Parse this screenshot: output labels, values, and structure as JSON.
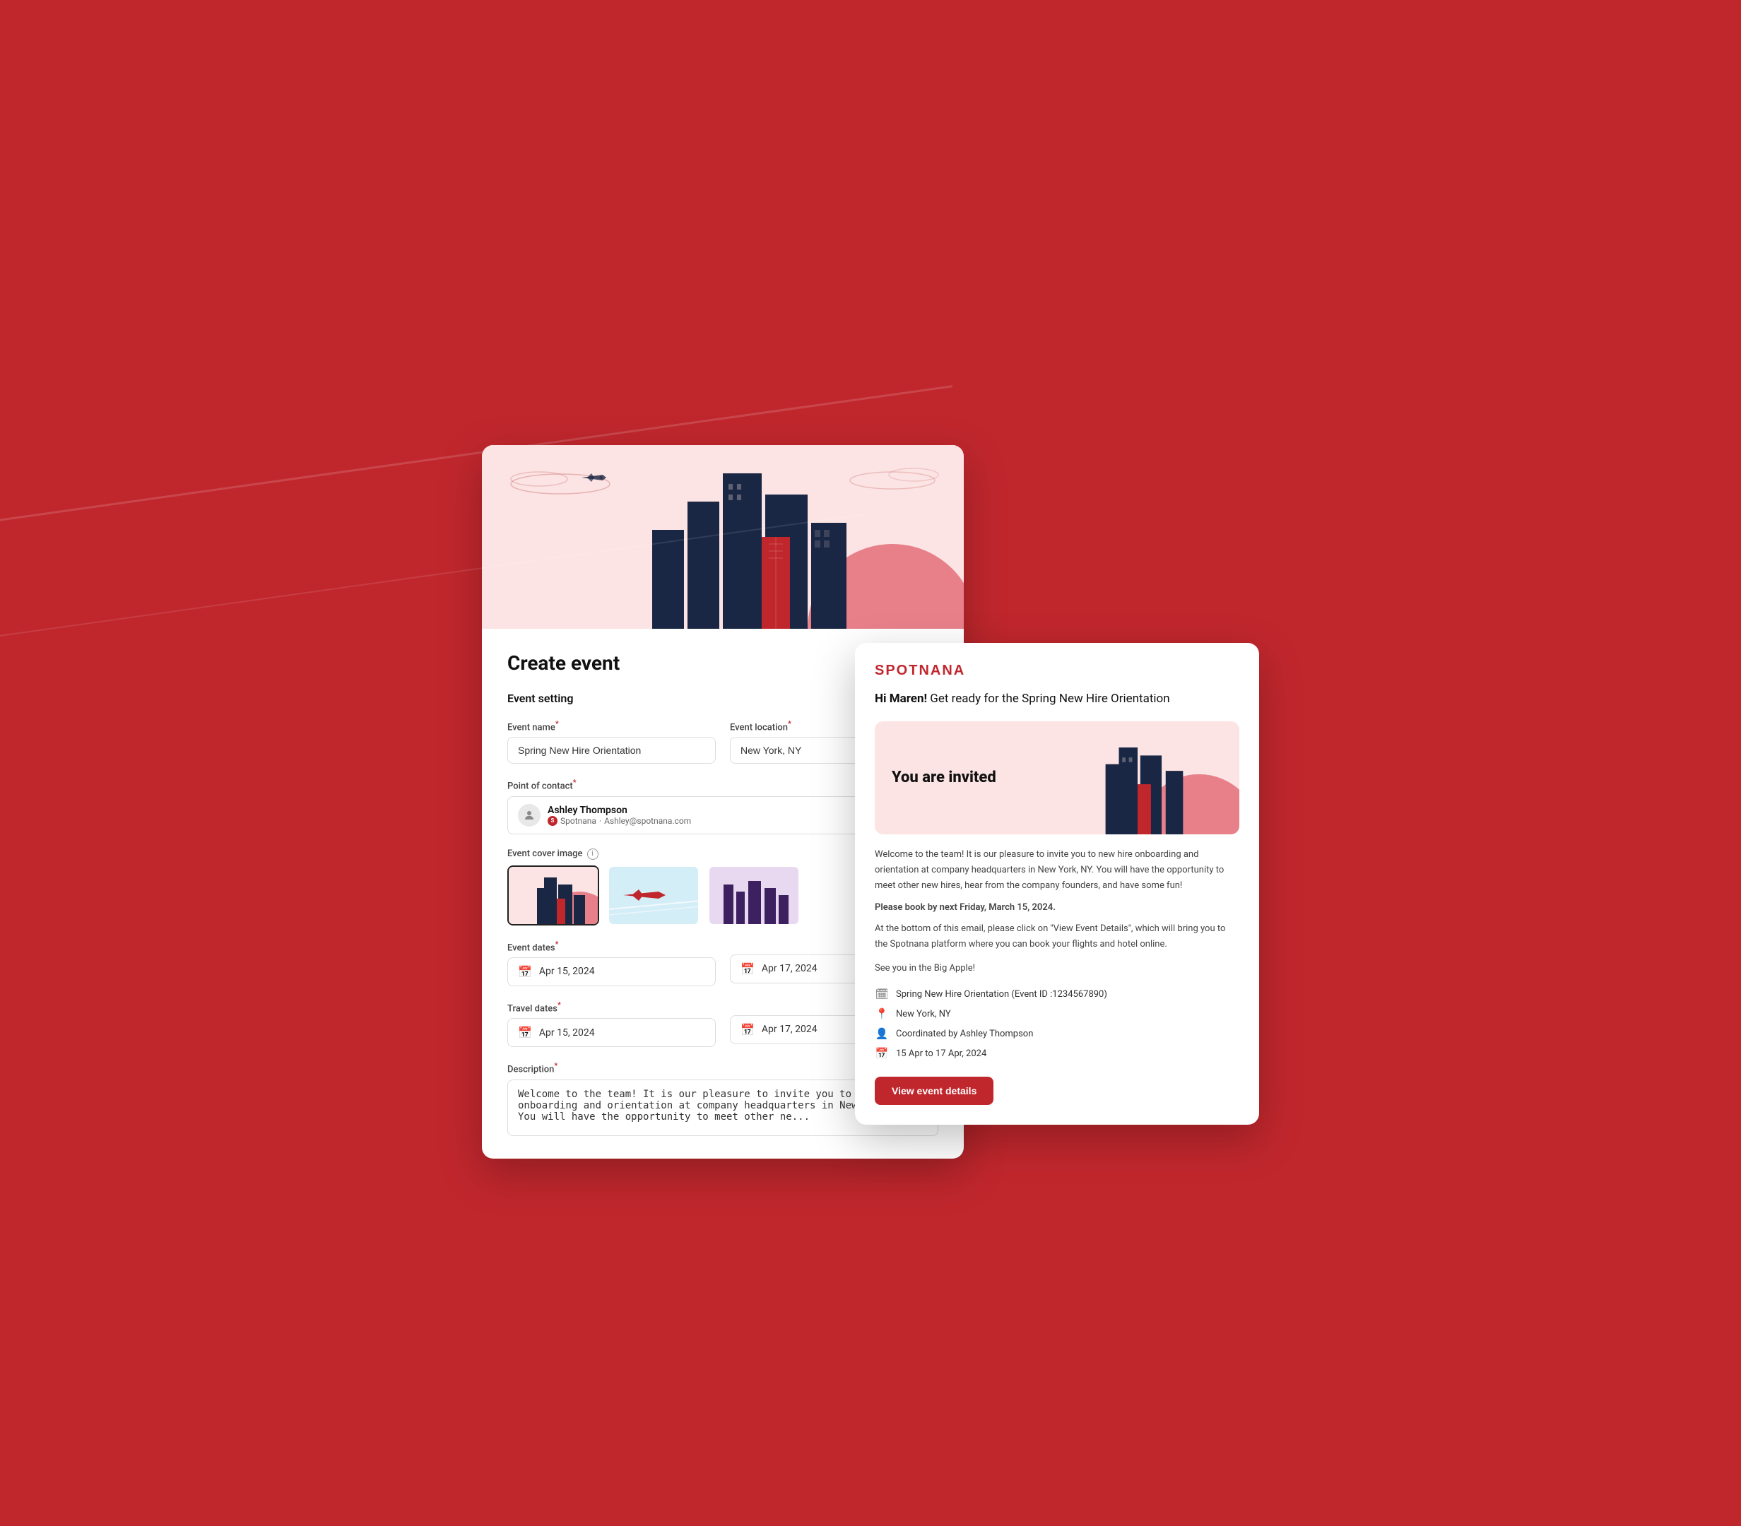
{
  "page": {
    "background_color": "#c0272d"
  },
  "create_event": {
    "title": "Create event",
    "section_label": "Event setting",
    "event_name_label": "Event name",
    "event_name_value": "Spring New Hire Orientation",
    "event_location_label": "Event location",
    "event_location_value": "New York, NY",
    "point_of_contact_label": "Point of contact",
    "contact_name": "Ashley Thompson",
    "contact_company": "Spotnana",
    "contact_email": "Ashley@spotnana.com",
    "cover_image_label": "Event cover image",
    "event_dates_label": "Event dates",
    "event_start_date": "Apr 15, 2024",
    "event_end_date": "Apr 17, 2024",
    "travel_dates_label": "Travel dates",
    "travel_start_date": "Apr 15, 2024",
    "travel_end_date": "Apr 17, 2024",
    "description_label": "Description",
    "description_value": "Welcome to the team! It is our pleasure to invite you to new hire onboarding and orientation at company headquarters in New York, NY.  You will have the opportunity to meet other ne..."
  },
  "email_preview": {
    "logo": "SPOTNANA",
    "greeting_prefix": "Hi Maren!",
    "greeting_text": " Get ready for the Spring New Hire Orientation",
    "hero_text": "You are invited",
    "body_paragraph1": "Welcome to the team! It is our pleasure to invite you to new hire onboarding and orientation at company headquarters in New York, NY.  You will have the opportunity to meet other new hires, hear from the company founders, and have some fun!",
    "body_paragraph2": "Please book by next Friday, March 15, 2024.",
    "body_paragraph3": "At the bottom of this email, please click on \"View Event Details\", which will bring you to the Spotnana platform where you can book your flights and hotel online.",
    "body_paragraph4": "See you in the Big Apple!",
    "detail_event": "Spring New Hire Orientation (Event ID :1234567890)",
    "detail_location": "New York, NY",
    "detail_coordinator": "Coordinated by Ashley Thompson",
    "detail_dates": "15 Apr to 17 Apr, 2024",
    "cta_button": "View event details"
  }
}
